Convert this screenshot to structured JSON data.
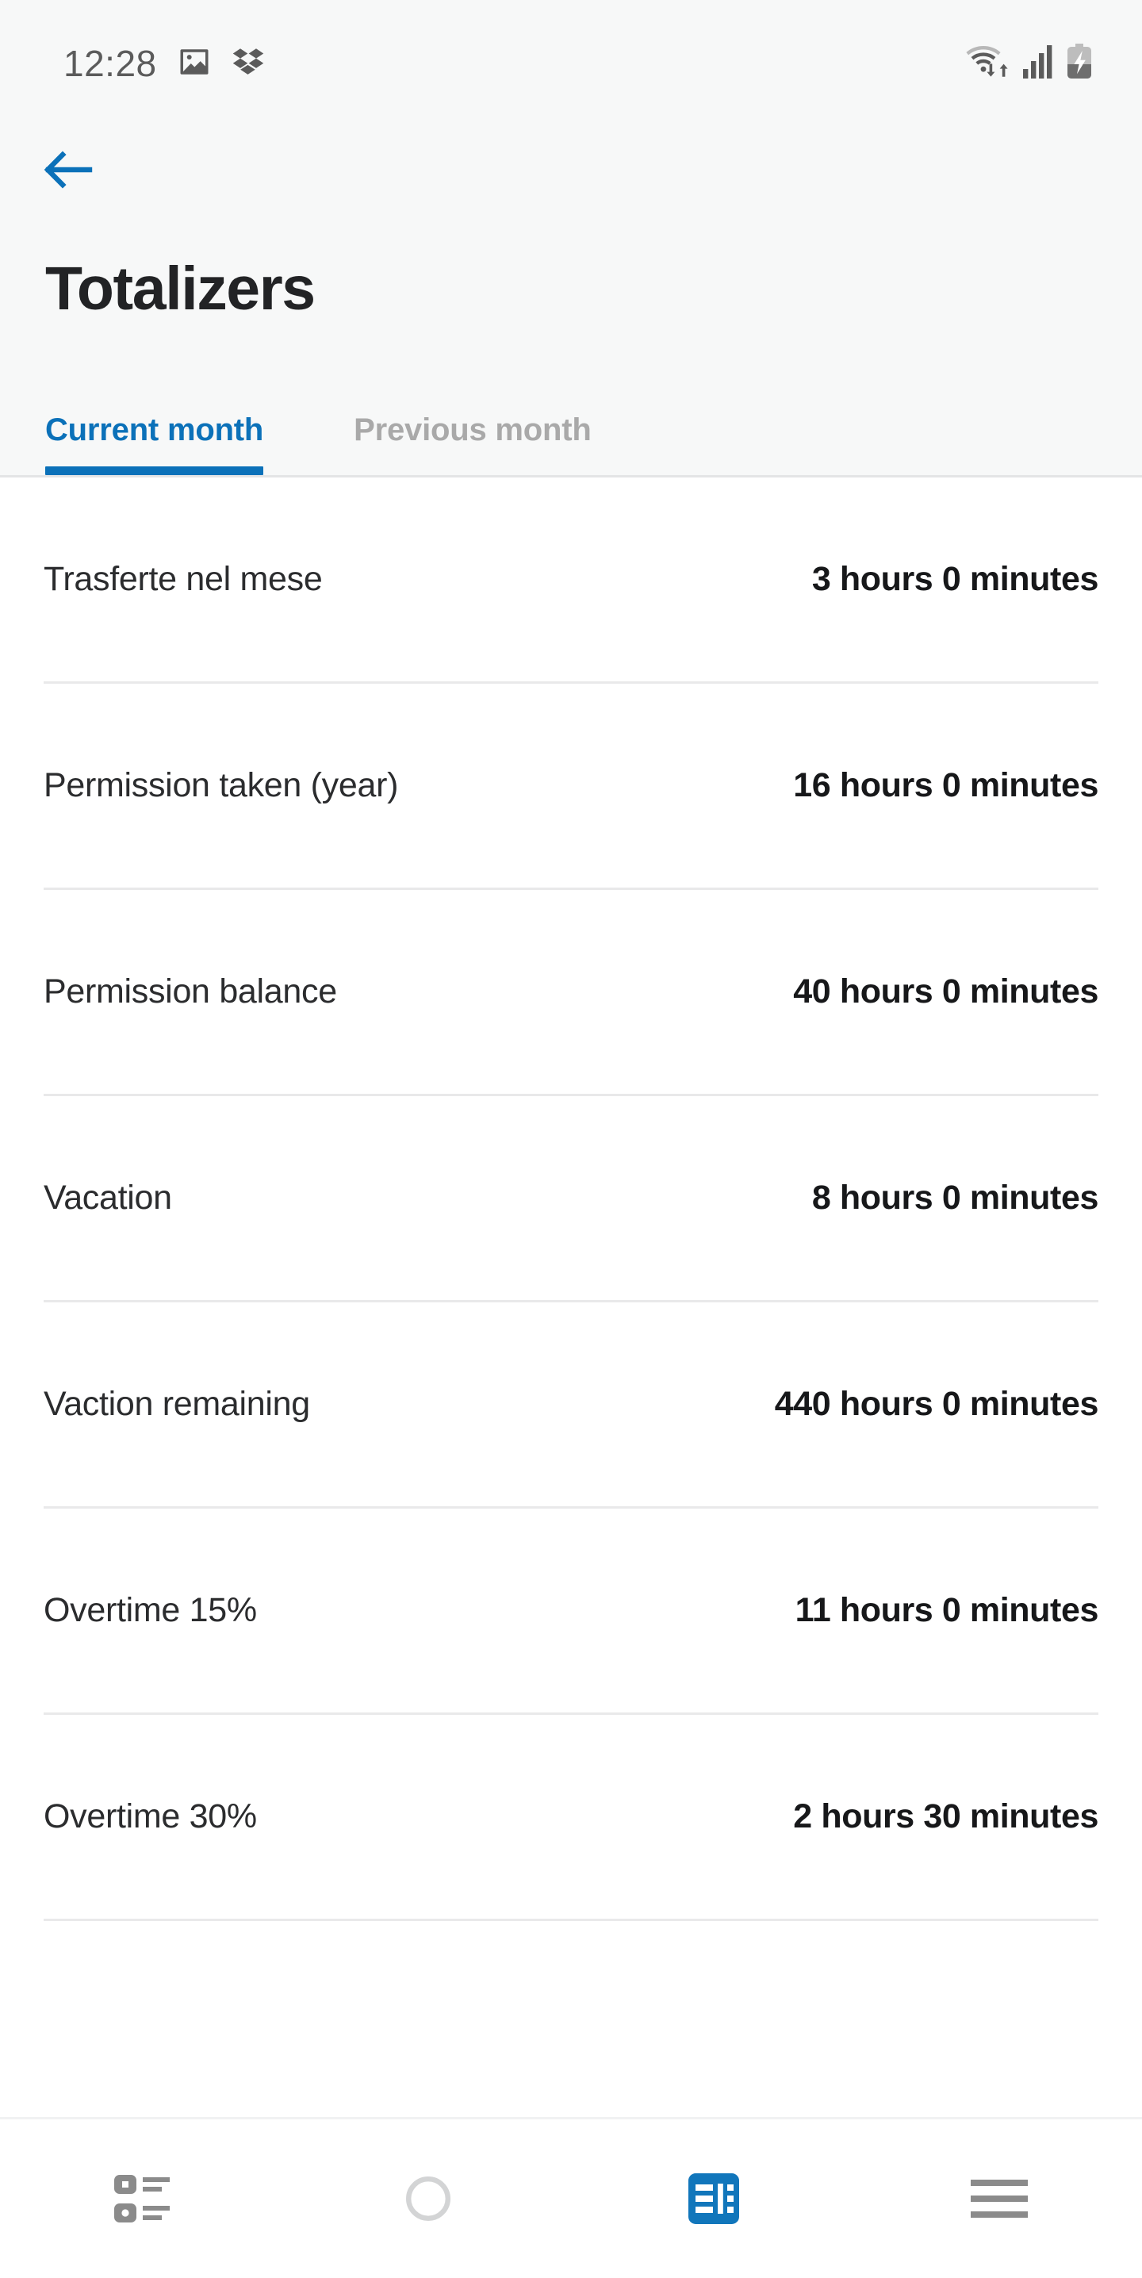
{
  "status_bar": {
    "time": "12:28",
    "left_icons": [
      {
        "name": "photo-gallery-icon"
      },
      {
        "name": "dropbox-icon"
      }
    ],
    "right_icons": [
      {
        "name": "wifi-data-transfer-icon"
      },
      {
        "name": "cellular-signal-icon"
      },
      {
        "name": "battery-charging-icon"
      }
    ]
  },
  "header": {
    "back_label": "Back",
    "title": "Totalizers"
  },
  "tabs": [
    {
      "label": "Current month",
      "active": true
    },
    {
      "label": "Previous month",
      "active": false
    }
  ],
  "totalizers": [
    {
      "label": "Trasferte nel mese",
      "value": "3 hours 0 minutes"
    },
    {
      "label": "Permission taken (year)",
      "value": "16 hours 0 minutes"
    },
    {
      "label": "Permission balance",
      "value": "40 hours 0 minutes"
    },
    {
      "label": "Vacation",
      "value": "8 hours 0 minutes"
    },
    {
      "label": "Vaction remaining",
      "value": "440 hours 0 minutes"
    },
    {
      "label": "Overtime 15%",
      "value": "11 hours 0 minutes"
    },
    {
      "label": "Overtime 30%",
      "value": "2 hours 30 minutes"
    }
  ],
  "bottom_nav": [
    {
      "name": "activity-list-icon",
      "active": false
    },
    {
      "name": "record-circle-icon",
      "active": false
    },
    {
      "name": "timesheet-icon",
      "active": true
    },
    {
      "name": "menu-hamburger-icon",
      "active": false
    }
  ],
  "colors": {
    "accent": "#0b71b9",
    "header_bg": "#f7f8f8",
    "content_bg": "#ffffff",
    "divider": "#e9e9ea",
    "label_text": "#2b2c2e",
    "value_text": "#17181a",
    "inactive_tab": "#a9a9a9",
    "nav_inactive": "#8b8b8b"
  }
}
